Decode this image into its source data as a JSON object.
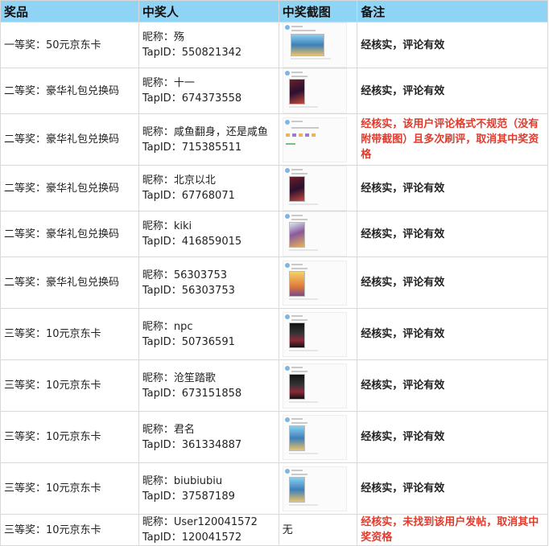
{
  "headers": {
    "prize": "奖品",
    "winner": "中奖人",
    "screenshot": "中奖截图",
    "note": "备注"
  },
  "labels": {
    "nick_prefix": "昵称：",
    "tap_prefix": "TapID："
  },
  "rows": [
    {
      "prize": "一等奖：50元京东卡",
      "nick": "殇",
      "tapid": "550821342",
      "shot": "wide",
      "note": "经核实，评论有效",
      "note_color": "normal"
    },
    {
      "prize": "二等奖：豪华礼包兑换码",
      "nick": "十一",
      "tapid": "674373558",
      "shot": "dark",
      "note": "经核实，评论有效",
      "note_color": "normal"
    },
    {
      "prize": "二等奖：豪华礼包兑换码",
      "nick": "咸鱼翻身，还是咸鱼",
      "tapid": "715385511",
      "shot": "textonly",
      "note": "经核实，该用户评论格式不规范（没有附带截图）且多次刷评，取消其中奖资格",
      "note_color": "red"
    },
    {
      "prize": "二等奖：豪华礼包兑换码",
      "nick": "北京以北",
      "tapid": "67768071",
      "shot": "dark",
      "note": "经核实，评论有效",
      "note_color": "normal"
    },
    {
      "prize": "二等奖：豪华礼包兑换码",
      "nick": "kiki",
      "tapid": "416859015",
      "shot": "light",
      "note": "经核实，评论有效",
      "note_color": "normal"
    },
    {
      "prize": "二等奖：豪华礼包兑换码",
      "nick": "56303753",
      "tapid": "56303753",
      "shot": "yellow",
      "note": "经核实，评论有效",
      "note_color": "normal"
    },
    {
      "prize": "三等奖：10元京东卡",
      "nick": "npc",
      "tapid": "50736591",
      "shot": "black",
      "note": "经核实，评论有效",
      "note_color": "normal"
    },
    {
      "prize": "三等奖：10元京东卡",
      "nick": "沧笙踏歌",
      "tapid": "673151858",
      "shot": "black",
      "note": "经核实，评论有效",
      "note_color": "normal"
    },
    {
      "prize": "三等奖：10元京东卡",
      "nick": "君名",
      "tapid": "361334887",
      "shot": "sky",
      "note": "经核实，评论有效",
      "note_color": "normal"
    },
    {
      "prize": "三等奖：10元京东卡",
      "nick": "biubiubiu",
      "tapid": "37587189",
      "shot": "sky",
      "note": "经核实，评论有效",
      "note_color": "normal"
    },
    {
      "prize": "三等奖：10元京东卡",
      "nick": "User120041572",
      "tapid": "120041572",
      "shot": "none",
      "shot_text": "无",
      "note": "经核实，未找到该用户发帖，取消其中奖资格",
      "note_color": "red"
    }
  ],
  "row_heights": [
    48,
    48,
    64,
    48,
    48,
    64,
    64,
    64,
    64,
    64,
    37
  ],
  "colors": {
    "header_bg": "#8fd3f5",
    "border": "#d9d9d9",
    "red_note": "#e03b2c"
  }
}
